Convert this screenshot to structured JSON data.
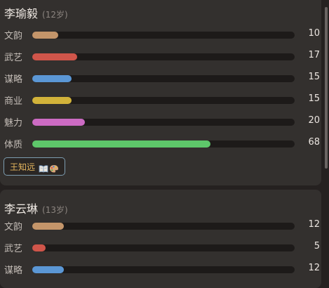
{
  "characters": [
    {
      "name": "李瑜毅",
      "age": "(12岁)",
      "stats": [
        {
          "label": "文韵",
          "value": "10",
          "level": 10,
          "color": "#c4956a"
        },
        {
          "label": "武艺",
          "value": "17",
          "level": 17,
          "color": "#d0554a"
        },
        {
          "label": "谋略",
          "value": "15",
          "level": 15,
          "color": "#5b97d5"
        },
        {
          "label": "商业",
          "value": "15",
          "level": 15,
          "color": "#d2b33a"
        },
        {
          "label": "魅力",
          "value": "20",
          "level": 20,
          "color": "#cc6bc3"
        },
        {
          "label": "体质",
          "value": "68",
          "level": 68,
          "color": "#5ec76a"
        }
      ],
      "tag": {
        "text": "王知远",
        "icons": [
          "open-book-icon",
          "painter-palette-icon"
        ]
      }
    },
    {
      "name": "李云琳",
      "age": "(13岁)",
      "stats": [
        {
          "label": "文韵",
          "value": "12",
          "level": 12,
          "color": "#c4956a"
        },
        {
          "label": "武艺",
          "value": "5",
          "level": 5,
          "color": "#d0554a"
        },
        {
          "label": "谋略",
          "value": "12",
          "level": 12,
          "color": "#5b97d5"
        }
      ]
    }
  ],
  "stat_max": 100
}
